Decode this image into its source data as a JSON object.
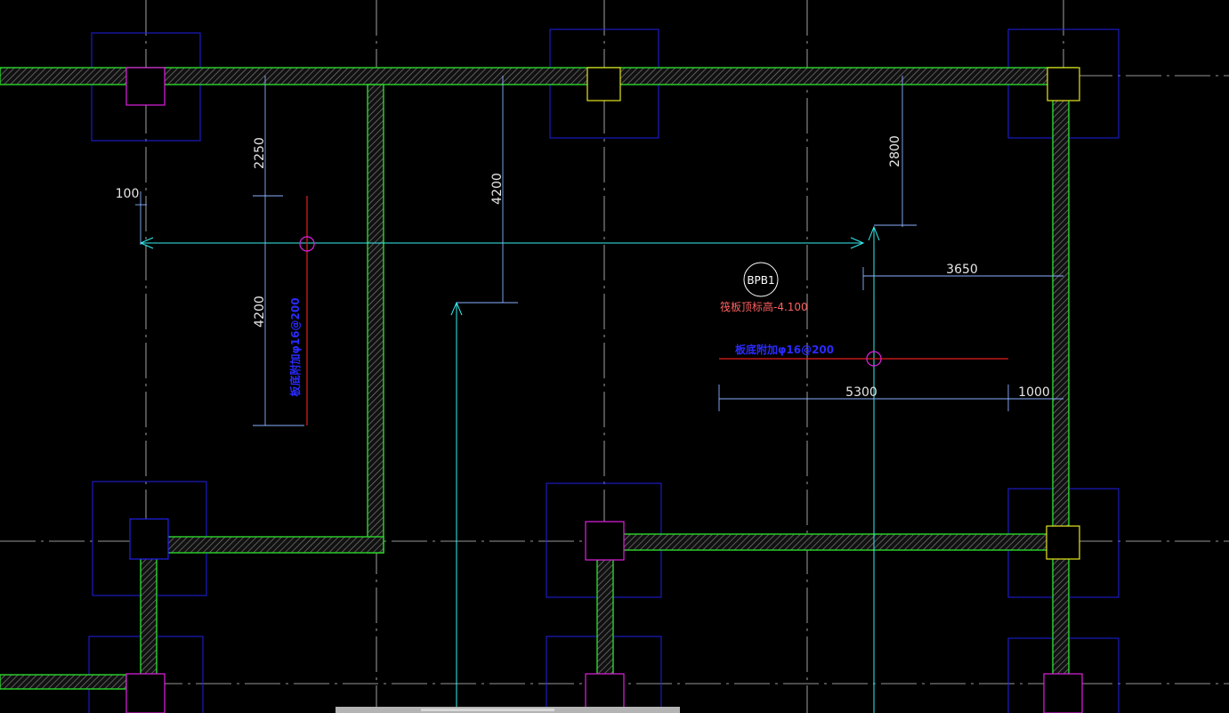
{
  "drawing": {
    "colors": {
      "background": "#000000",
      "grid_axis": "#c8c8c8",
      "wall_outline": "#2ad62a",
      "wall_hatch": "#6a6a6a",
      "footing": "#1e1ee6",
      "column_magenta": "#e61ee6",
      "column_yellow": "#e6e61e",
      "column_blue": "#1e1ee6",
      "dimension": "#8ab0ff",
      "section_cyan": "#35f0f0",
      "rebar_red": "#e61e1e"
    },
    "dimensions": {
      "d_2250": "2250",
      "d_100": "100",
      "d_4200_left": "4200",
      "d_4200_mid": "4200",
      "d_2800": "2800",
      "d_3650": "3650",
      "d_5300": "5300",
      "d_1000": "1000"
    },
    "slab_tag": {
      "label": "BPB1",
      "elevation_note": "筏板顶标高-4.100"
    },
    "rebar_notes": {
      "vertical": "板底附加φ16@200",
      "horizontal": "板底附加φ16@200"
    }
  }
}
